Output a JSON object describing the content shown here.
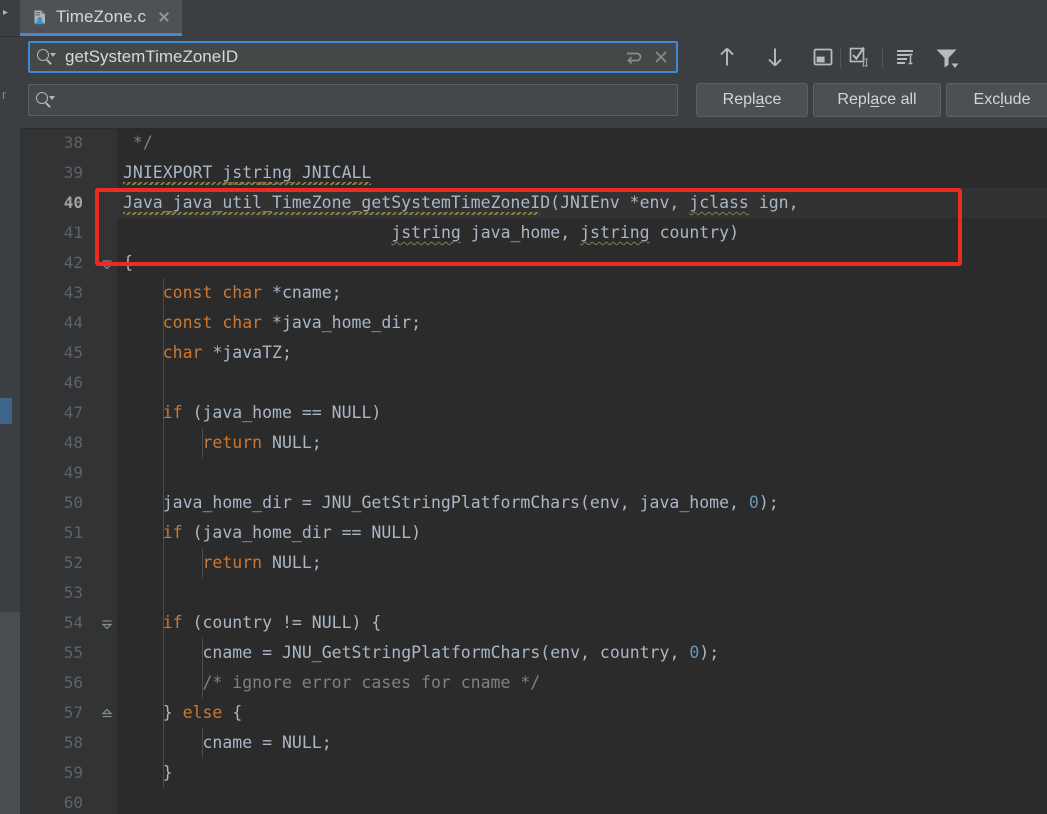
{
  "window": {
    "background_color": "#3c3f41",
    "editor_background": "#2b2b2b"
  },
  "left_strip": {
    "ghost_label": "r",
    "collapse_icon": "chevron-right-icon"
  },
  "tabs": [
    {
      "label": "TimeZone.c",
      "icon": "c-file-icon",
      "active": true,
      "close_icon": "close-icon"
    }
  ],
  "find_panel": {
    "search": {
      "value": "getSystemTimeZoneID",
      "placeholder": "",
      "icon": "search-icon",
      "history_icon": "search-history-icon",
      "clear_icon": "clear-icon",
      "focus_color": "#3f8ad8"
    },
    "replace": {
      "value": "",
      "placeholder": "",
      "icon": "search-icon"
    },
    "nav_icons": [
      {
        "name": "find-previous-icon",
        "glyph": "arrow-up"
      },
      {
        "name": "find-next-icon",
        "glyph": "arrow-down"
      },
      {
        "name": "open-in-find-window-icon",
        "glyph": "open-panel"
      }
    ],
    "option_icons": [
      {
        "name": "match-case-icon",
        "glyph": "checkbox-II"
      },
      {
        "name": "words-icon",
        "glyph": "lines-with-I"
      },
      {
        "name": "filter-icon",
        "glyph": "funnel-dropdown"
      }
    ],
    "buttons": [
      {
        "label": "Replace",
        "mnemonic": "a"
      },
      {
        "label": "Replace all",
        "mnemonic": "a"
      },
      {
        "label": "Exclude",
        "mnemonic": "l"
      }
    ]
  },
  "editor": {
    "selection_color": "#2f5f9a",
    "current_line": 40,
    "annotation": {
      "shape": "rectangle",
      "color": "#ee2b23"
    },
    "lines": [
      {
        "n": 38,
        "text": " */"
      },
      {
        "n": 39,
        "text": "JNIEXPORT jstring JNICALL"
      },
      {
        "n": 40,
        "text": "Java_java_util_TimeZone_getSystemTimeZoneID(JNIEnv *env, jclass ign,"
      },
      {
        "n": 41,
        "text": "                           jstring java_home, jstring country)"
      },
      {
        "n": 42,
        "text": "{"
      },
      {
        "n": 43,
        "text": "    const char *cname;"
      },
      {
        "n": 44,
        "text": "    const char *java_home_dir;"
      },
      {
        "n": 45,
        "text": "    char *javaTZ;"
      },
      {
        "n": 46,
        "text": ""
      },
      {
        "n": 47,
        "text": "    if (java_home == NULL)"
      },
      {
        "n": 48,
        "text": "        return NULL;"
      },
      {
        "n": 49,
        "text": ""
      },
      {
        "n": 50,
        "text": "    java_home_dir = JNU_GetStringPlatformChars(env, java_home, 0);"
      },
      {
        "n": 51,
        "text": "    if (java_home_dir == NULL)"
      },
      {
        "n": 52,
        "text": "        return NULL;"
      },
      {
        "n": 53,
        "text": ""
      },
      {
        "n": 54,
        "text": "    if (country != NULL) {"
      },
      {
        "n": 55,
        "text": "        cname = JNU_GetStringPlatformChars(env, country, 0);"
      },
      {
        "n": 56,
        "text": "        /* ignore error cases for cname */"
      },
      {
        "n": 57,
        "text": "    } else {"
      },
      {
        "n": 58,
        "text": "        cname = NULL;"
      },
      {
        "n": 59,
        "text": "    }"
      },
      {
        "n": 60,
        "text": ""
      }
    ],
    "search_match": "getSystemTimeZoneID",
    "fold_markers": [
      {
        "line": 42,
        "type": "fold-collapse-icon"
      },
      {
        "line": 54,
        "type": "fold-collapse-icon"
      },
      {
        "line": 57,
        "type": "fold-end-icon"
      }
    ]
  }
}
